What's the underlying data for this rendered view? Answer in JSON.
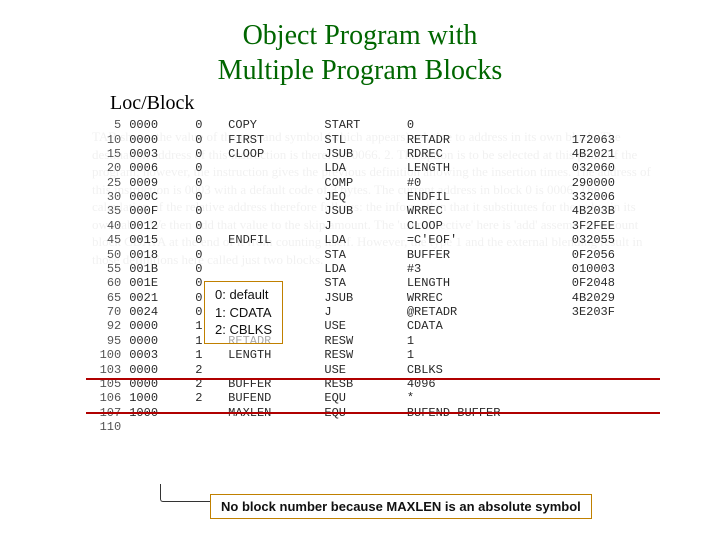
{
  "title_line1": "Object Program with",
  "title_line2": "Multiple Program Blocks",
  "locblock_label": "Loc/Block",
  "key": {
    "l0": "0: default",
    "l1": "1: CDATA",
    "l2": "2: CBLKS"
  },
  "note": "No block number because MAXLEN is an absolute symbol",
  "rows": [
    {
      "ln": "5",
      "loc": "0000",
      "blk": "0",
      "lab": "COPY",
      "op": "START",
      "oper": "0",
      "obj": ""
    },
    {
      "ln": "10",
      "loc": "0000",
      "blk": "0",
      "lab": "FIRST",
      "op": "STL",
      "oper": "RETADR",
      "obj": "172063"
    },
    {
      "ln": "15",
      "loc": "0003",
      "blk": "0",
      "lab": "CLOOP",
      "op": "JSUB",
      "oper": "RDREC",
      "obj": "4B2021"
    },
    {
      "ln": "20",
      "loc": "0006",
      "blk": "0",
      "lab": "",
      "op": "LDA",
      "oper": "LENGTH",
      "obj": "032060"
    },
    {
      "ln": "25",
      "loc": "0009",
      "blk": "0",
      "lab": "",
      "op": "COMP",
      "oper": "#0",
      "obj": "290000"
    },
    {
      "ln": "30",
      "loc": "000C",
      "blk": "0",
      "lab": "",
      "op": "JEQ",
      "oper": "ENDFIL",
      "obj": "332006"
    },
    {
      "ln": "35",
      "loc": "000F",
      "blk": "0",
      "lab": "",
      "op": "JSUB",
      "oper": "WRREC",
      "obj": "4B203B"
    },
    {
      "ln": "40",
      "loc": "0012",
      "blk": "0",
      "lab": "",
      "op": "J",
      "oper": "CLOOP",
      "obj": "3F2FEE"
    },
    {
      "ln": "45",
      "loc": "0015",
      "blk": "0",
      "lab": "ENDFIL",
      "op": "LDA",
      "oper": "=C'EOF'",
      "obj": "032055"
    },
    {
      "ln": "50",
      "loc": "0018",
      "blk": "0",
      "lab": "",
      "op": "STA",
      "oper": "BUFFER",
      "obj": "0F2056"
    },
    {
      "ln": "55",
      "loc": "001B",
      "blk": "0",
      "lab": "",
      "op": "LDA",
      "oper": "#3",
      "obj": "010003"
    },
    {
      "ln": "60",
      "loc": "001E",
      "blk": "0",
      "lab": "",
      "op": "STA",
      "oper": "LENGTH",
      "obj": "0F2048"
    },
    {
      "ln": "65",
      "loc": "0021",
      "blk": "0",
      "lab": "",
      "op": "JSUB",
      "oper": "WRREC",
      "obj": "4B2029"
    },
    {
      "ln": "70",
      "loc": "0024",
      "blk": "0",
      "lab": "",
      "op": "J",
      "oper": "@RETADR",
      "obj": "3E203F"
    },
    {
      "ln": "92",
      "loc": "0000",
      "blk": "1",
      "lab": "",
      "op": "USE",
      "oper": "CDATA",
      "obj": ""
    },
    {
      "ln": "95",
      "loc": "0000",
      "blk": "1",
      "lab": "RETADR",
      "op": "RESW",
      "oper": "1",
      "obj": ""
    },
    {
      "ln": "100",
      "loc": "0003",
      "blk": "1",
      "lab": "LENGTH",
      "op": "RESW",
      "oper": "1",
      "obj": ""
    },
    {
      "ln": "103",
      "loc": "0000",
      "blk": "2",
      "lab": "",
      "op": "USE",
      "oper": "CBLKS",
      "obj": ""
    },
    {
      "ln": "105",
      "loc": "0000",
      "blk": "2",
      "lab": "BUFFER",
      "op": "RESB",
      "oper": "4096",
      "obj": ""
    },
    {
      "ln": "106",
      "loc": "1000",
      "blk": "2",
      "lab": "BUFEND",
      "op": "EQU",
      "oper": "*",
      "obj": ""
    },
    {
      "ln": "107",
      "loc": "1000",
      "blk": "",
      "lab": "MAXLEN",
      "op": "EQU",
      "oper": "BUFEND-BUFFER",
      "obj": ""
    },
    {
      "ln": "110",
      "loc": "",
      "blk": "",
      "lab": "",
      "op": "",
      "oper": "",
      "obj": ""
    }
  ],
  "ghost_text": "TAB shows the value of the operand symbol (which appears) relative to address in its own block. The destination address of this instruction is therefore 0066. 2. The option is to be selected at this point of the program; however, the instruction gives the previous definition allowing the insertion times. The address of this instruction is 0003 with a default code of 3 bytes. The current address in block 0 is 0006. The calculation of the relative address therefore follows: the information that it substitutes for the value in its own table. We then add that value to the skip amount. The 'user-directive' here is 'add' assembler to count block CDATA at the end of it from counting itself. However, the type 1 and the external blending result in those definitions here called just two blocks."
}
